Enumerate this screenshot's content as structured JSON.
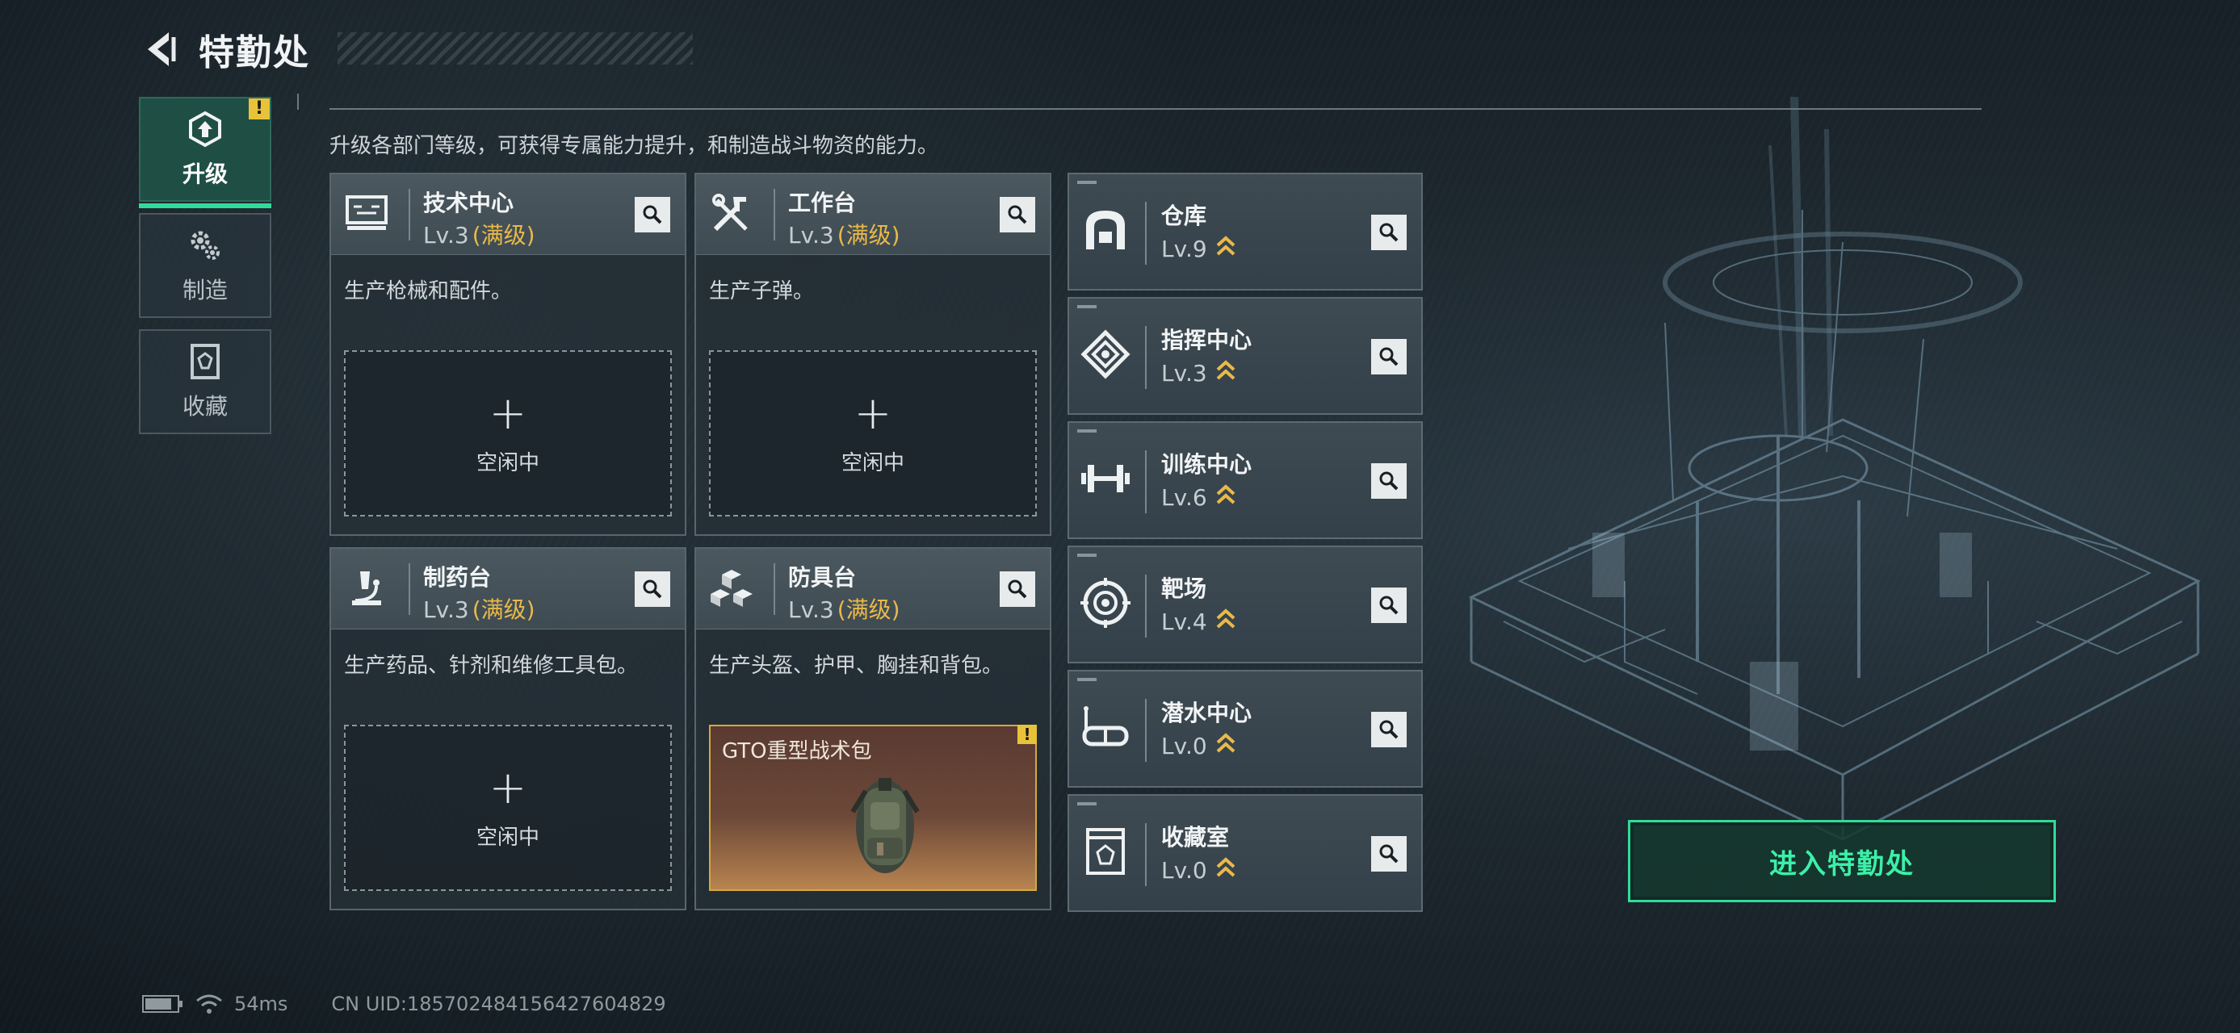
{
  "header": {
    "title": "特勤处"
  },
  "nav": [
    {
      "label": "升级",
      "icon": "upgrade-icon",
      "active": true,
      "alert": "!"
    },
    {
      "label": "制造",
      "icon": "gears-icon",
      "active": false
    },
    {
      "label": "收藏",
      "icon": "collection-icon",
      "active": false
    }
  ],
  "description": "升级各部门等级，可获得专属能力提升，和制造战斗物资的能力。",
  "workshops": [
    {
      "name": "技术中心",
      "level": "Lv.3",
      "maxed": "(满级)",
      "desc": "生产枪械和配件。",
      "slot": {
        "plus": "+",
        "label": "空闲中"
      }
    },
    {
      "name": "工作台",
      "level": "Lv.3",
      "maxed": "(满级)",
      "desc": "生产子弹。",
      "slot": {
        "plus": "+",
        "label": "空闲中"
      }
    },
    {
      "name": "制药台",
      "level": "Lv.3",
      "maxed": "(满级)",
      "desc": "生产药品、针剂和维修工具包。",
      "slot": {
        "plus": "+",
        "label": "空闲中"
      }
    },
    {
      "name": "防具台",
      "level": "Lv.3",
      "maxed": "(满级)",
      "desc": "生产头盔、护甲、胸挂和背包。",
      "product": {
        "name": "GTO重型战术包",
        "alert": "!"
      }
    }
  ],
  "facilities": [
    {
      "name": "仓库",
      "level": "Lv.9",
      "icon": "warehouse-icon"
    },
    {
      "name": "指挥中心",
      "level": "Lv.3",
      "icon": "command-center-icon"
    },
    {
      "name": "训练中心",
      "level": "Lv.6",
      "icon": "dumbbell-icon"
    },
    {
      "name": "靶场",
      "level": "Lv.4",
      "icon": "target-icon"
    },
    {
      "name": "潜水中心",
      "level": "Lv.0",
      "icon": "diving-mask-icon"
    },
    {
      "name": "收藏室",
      "level": "Lv.0",
      "icon": "collection-room-icon"
    }
  ],
  "enter_button": "进入特勤处",
  "status": {
    "battery_level": 0.85,
    "ping": "54ms",
    "uid": "CN UID:185702484156427604829"
  },
  "colors": {
    "accent": "#2fdc9a",
    "gold": "#e9b94a",
    "alert": "#e8c33a"
  }
}
